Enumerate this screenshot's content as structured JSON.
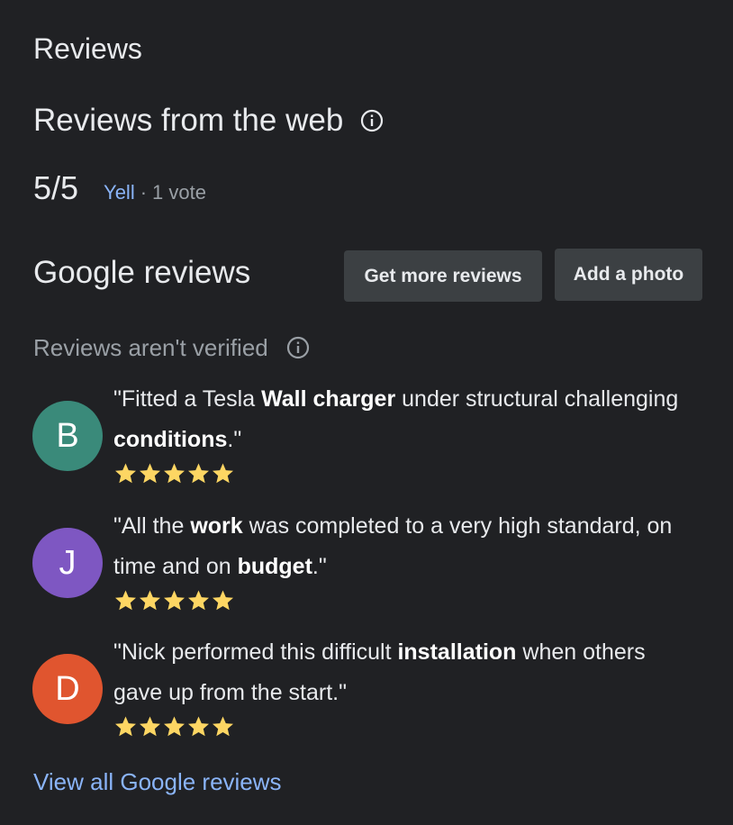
{
  "header": {
    "title": "Reviews"
  },
  "web_reviews": {
    "heading": "Reviews from the web",
    "score": "5/5",
    "source": "Yell",
    "separator": "·",
    "votes": "1 vote"
  },
  "google_reviews": {
    "heading": "Google reviews",
    "get_more_label": "Get more reviews",
    "add_photo_label": "Add a photo",
    "unverified_note": "Reviews aren't verified",
    "view_all_label": "View all Google reviews"
  },
  "reviews": [
    {
      "initial": "B",
      "avatar_color": "#3a8a7a",
      "stars": 5,
      "segments": [
        {
          "text": "\"Fitted a Tesla ",
          "bold": false
        },
        {
          "text": "Wall charger",
          "bold": true
        },
        {
          "text": " under structural challenging ",
          "bold": false
        },
        {
          "text": "conditions",
          "bold": true
        },
        {
          "text": ".\"",
          "bold": false
        }
      ]
    },
    {
      "initial": "J",
      "avatar_color": "#7e57c2",
      "stars": 5,
      "segments": [
        {
          "text": "\"All the ",
          "bold": false
        },
        {
          "text": "work",
          "bold": true
        },
        {
          "text": " was completed to a very high standard, on time and on ",
          "bold": false
        },
        {
          "text": "budget",
          "bold": true
        },
        {
          "text": ".\"",
          "bold": false
        }
      ]
    },
    {
      "initial": "D",
      "avatar_color": "#e0552f",
      "stars": 5,
      "segments": [
        {
          "text": "\"Nick performed this difficult ",
          "bold": false
        },
        {
          "text": "installation",
          "bold": true
        },
        {
          "text": " when others gave up from the start.\"",
          "bold": false
        }
      ]
    }
  ],
  "colors": {
    "background": "#202124",
    "link": "#8ab4f8",
    "star": "#fdd663",
    "button_bg": "#3c4043"
  }
}
